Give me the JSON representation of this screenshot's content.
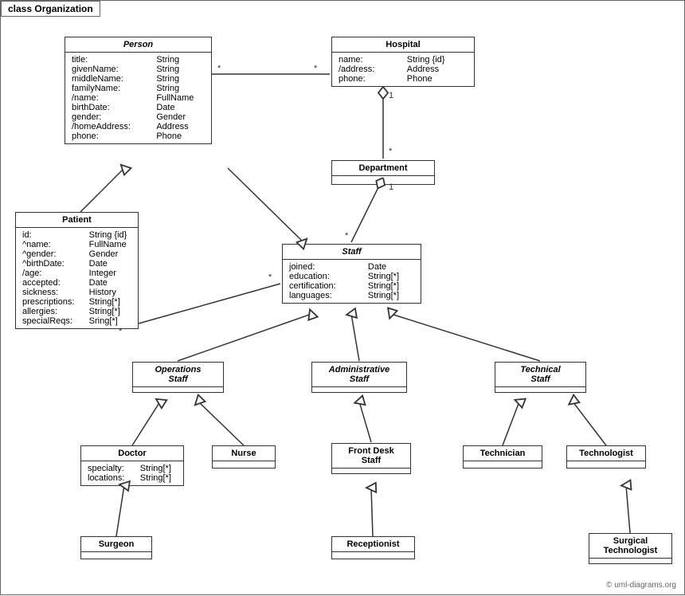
{
  "title": "class Organization",
  "copyright": "© uml-diagrams.org",
  "classes": {
    "person": {
      "name": "Person",
      "italic": true,
      "attributes": [
        [
          "title:",
          "String"
        ],
        [
          "givenName:",
          "String"
        ],
        [
          "middleName:",
          "String"
        ],
        [
          "familyName:",
          "String"
        ],
        [
          "/name:",
          "FullName"
        ],
        [
          "birthDate:",
          "Date"
        ],
        [
          "gender:",
          "Gender"
        ],
        [
          "/homeAddress:",
          "Address"
        ],
        [
          "phone:",
          "Phone"
        ]
      ]
    },
    "hospital": {
      "name": "Hospital",
      "italic": false,
      "attributes": [
        [
          "name:",
          "String {id}"
        ],
        [
          "/address:",
          "Address"
        ],
        [
          "phone:",
          "Phone"
        ]
      ]
    },
    "department": {
      "name": "Department",
      "italic": false,
      "attributes": []
    },
    "patient": {
      "name": "Patient",
      "italic": false,
      "attributes": [
        [
          "id:",
          "String {id}"
        ],
        [
          "^name:",
          "FullName"
        ],
        [
          "^gender:",
          "Gender"
        ],
        [
          "^birthDate:",
          "Date"
        ],
        [
          "/age:",
          "Integer"
        ],
        [
          "accepted:",
          "Date"
        ],
        [
          "sickness:",
          "History"
        ],
        [
          "prescriptions:",
          "String[*]"
        ],
        [
          "allergies:",
          "String[*]"
        ],
        [
          "specialReqs:",
          "Sring[*]"
        ]
      ]
    },
    "staff": {
      "name": "Staff",
      "italic": true,
      "attributes": [
        [
          "joined:",
          "Date"
        ],
        [
          "education:",
          "String[*]"
        ],
        [
          "certification:",
          "String[*]"
        ],
        [
          "languages:",
          "String[*]"
        ]
      ]
    },
    "operationsStaff": {
      "name": "Operations\nStaff",
      "italic": true,
      "attributes": []
    },
    "administrativeStaff": {
      "name": "Administrative\nStaff",
      "italic": true,
      "attributes": []
    },
    "technicalStaff": {
      "name": "Technical\nStaff",
      "italic": true,
      "attributes": []
    },
    "doctor": {
      "name": "Doctor",
      "italic": false,
      "attributes": [
        [
          "specialty:",
          "String[*]"
        ],
        [
          "locations:",
          "String[*]"
        ]
      ]
    },
    "nurse": {
      "name": "Nurse",
      "italic": false,
      "attributes": []
    },
    "frontDeskStaff": {
      "name": "Front Desk\nStaff",
      "italic": false,
      "attributes": []
    },
    "technician": {
      "name": "Technician",
      "italic": false,
      "attributes": []
    },
    "technologist": {
      "name": "Technologist",
      "italic": false,
      "attributes": []
    },
    "surgeon": {
      "name": "Surgeon",
      "italic": false,
      "attributes": []
    },
    "receptionist": {
      "name": "Receptionist",
      "italic": false,
      "attributes": []
    },
    "surgicalTechnologist": {
      "name": "Surgical\nTechnologist",
      "italic": false,
      "attributes": []
    }
  },
  "labels": {
    "star1": "*",
    "star2": "*",
    "star3": "*",
    "star4": "*",
    "one1": "1",
    "one2": "1"
  }
}
